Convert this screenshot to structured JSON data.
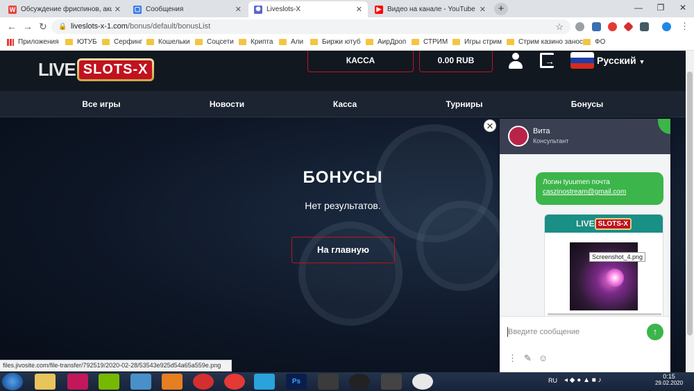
{
  "browser": {
    "tabs": [
      {
        "title": "Обсуждение фриспинов, акций",
        "icon": "w-favicon-icon",
        "color": "#e8453c",
        "glyph": "W"
      },
      {
        "title": "Сообщения",
        "icon": "messages-favicon-icon",
        "color": "#3b7be8",
        "glyph": "▢"
      },
      {
        "title": "Liveslots-X",
        "icon": "liveslots-favicon-icon",
        "color": "#5966d1",
        "glyph": "✺"
      },
      {
        "title": "Видео на канале - YouTube Stu",
        "icon": "youtube-favicon-icon",
        "color": "#ff0000",
        "glyph": "▶"
      }
    ],
    "new_tab": "+",
    "window_controls": {
      "minimize": "—",
      "maximize": "❐",
      "close": "✕"
    },
    "nav": {
      "back": "←",
      "forward": "→",
      "reload": "↻"
    },
    "url": {
      "host": "liveslots-x-1.com",
      "path": "/bonus/default/bonusList"
    },
    "bookmarks": [
      {
        "label": "Приложения",
        "type": "apps"
      },
      {
        "label": "ЮТУБ",
        "type": "folder"
      },
      {
        "label": "Серфинг",
        "type": "folder"
      },
      {
        "label": "Кошельки",
        "type": "folder"
      },
      {
        "label": "Соцсети",
        "type": "folder"
      },
      {
        "label": "Крипта",
        "type": "folder"
      },
      {
        "label": "Али",
        "type": "folder"
      },
      {
        "label": "Биржи ютуб",
        "type": "folder"
      },
      {
        "label": "АирДроп",
        "type": "folder"
      },
      {
        "label": "СТРИМ",
        "type": "folder"
      },
      {
        "label": "Игры стрим",
        "type": "folder"
      },
      {
        "label": "Стрим казино занос",
        "type": "folder"
      },
      {
        "label": "ФО",
        "type": "folder"
      }
    ],
    "status_url": "files.jivosite.com/file-transfer/792519/2020-02-28/53543e925d54a65a559e.png"
  },
  "site": {
    "logo": {
      "live": "LIVE",
      "slots": "SLOTS-X"
    },
    "header": {
      "kassa": "КАССА",
      "balance": "0.00 RUB",
      "language": "Русский"
    },
    "nav": [
      "Все игры",
      "Новости",
      "Касса",
      "Турниры",
      "Бонусы"
    ],
    "hero": {
      "title": "БОНУСЫ",
      "subtitle": "Нет результатов.",
      "home_button": "На главную"
    }
  },
  "chat": {
    "agent_name": "Вита",
    "agent_role": "Консультант",
    "message_line1": "Логин tyuumen почта",
    "message_email": "caszinostream@gmail.com",
    "attachment_tooltip": "Screenshot_4.png",
    "card_logo_live": "LIVE",
    "card_logo_slots": "SLOTS-X",
    "input_placeholder": "Введите сообщение"
  },
  "taskbar": {
    "language": "RU",
    "time": "0:15",
    "date": "29.02.2020"
  }
}
